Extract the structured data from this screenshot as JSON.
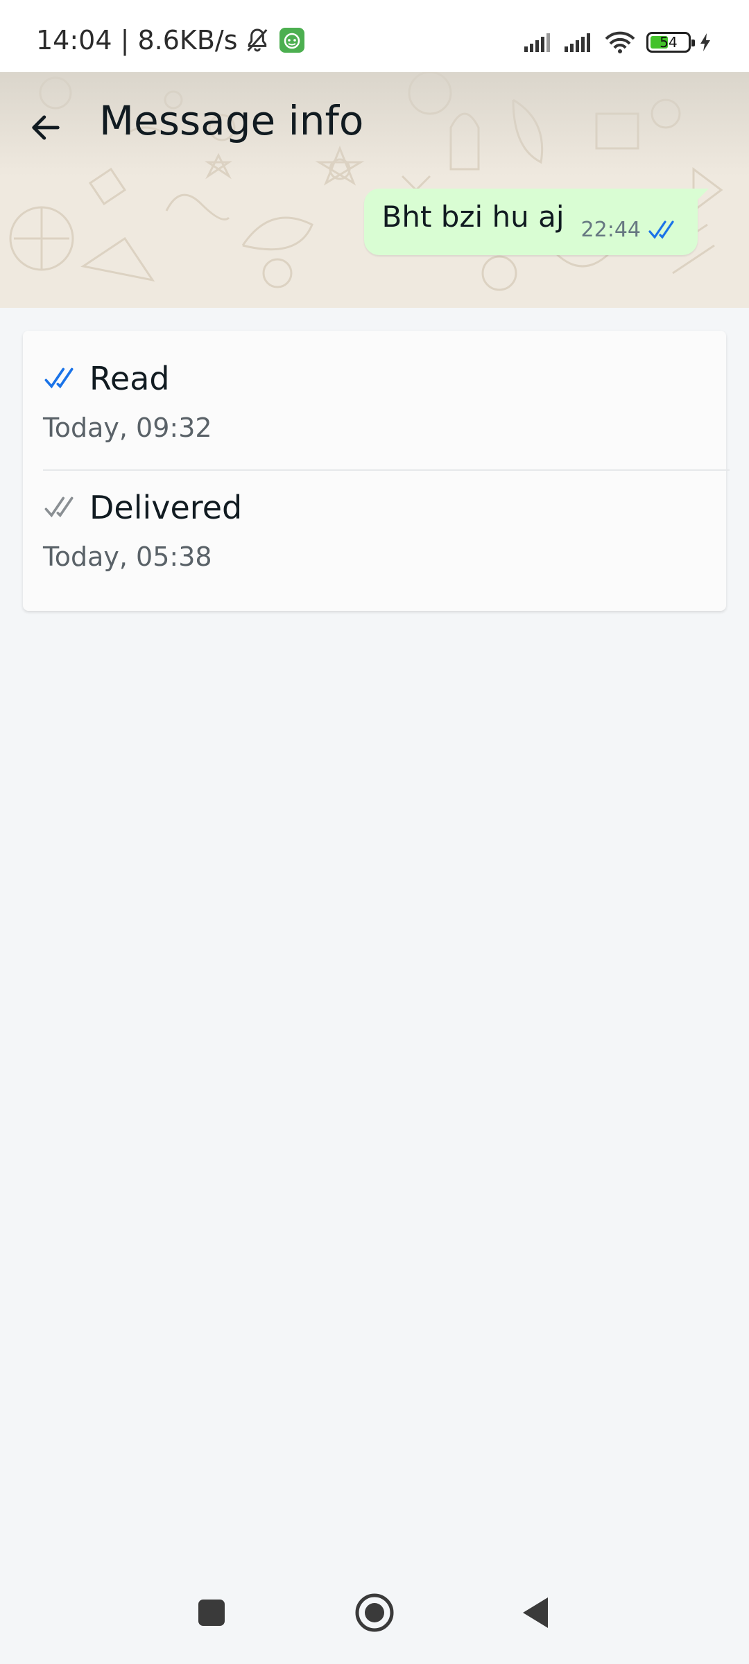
{
  "status_bar": {
    "time_speed": "14:04 | 8.6KB/s",
    "battery_level": "54",
    "battery_fraction": 0.54,
    "icons": [
      "bell-off-icon",
      "app-notification-icon",
      "signal-icon",
      "signal-icon",
      "wifi-icon",
      "battery-icon",
      "charging-icon"
    ]
  },
  "header": {
    "title": "Message info",
    "back_icon": "arrow-left-icon"
  },
  "message": {
    "text": "Bht bzi hu aj",
    "time": "22:44",
    "status_icon": "double-check-read-icon"
  },
  "receipts": [
    {
      "label": "Read",
      "time": "Today, 09:32",
      "icon": "double-check-read-icon",
      "color": "#1a73e8"
    },
    {
      "label": "Delivered",
      "time": "Today, 05:38",
      "icon": "double-check-delivered-icon",
      "color": "#8a8f93"
    }
  ],
  "nav": {
    "icons": [
      "recents-icon",
      "home-icon",
      "back-icon"
    ]
  },
  "colors": {
    "bubble": "#d9fdd3",
    "read_tick": "#1a73e8",
    "delivered_tick": "#8a8f93",
    "background": "#f4f6f8"
  }
}
